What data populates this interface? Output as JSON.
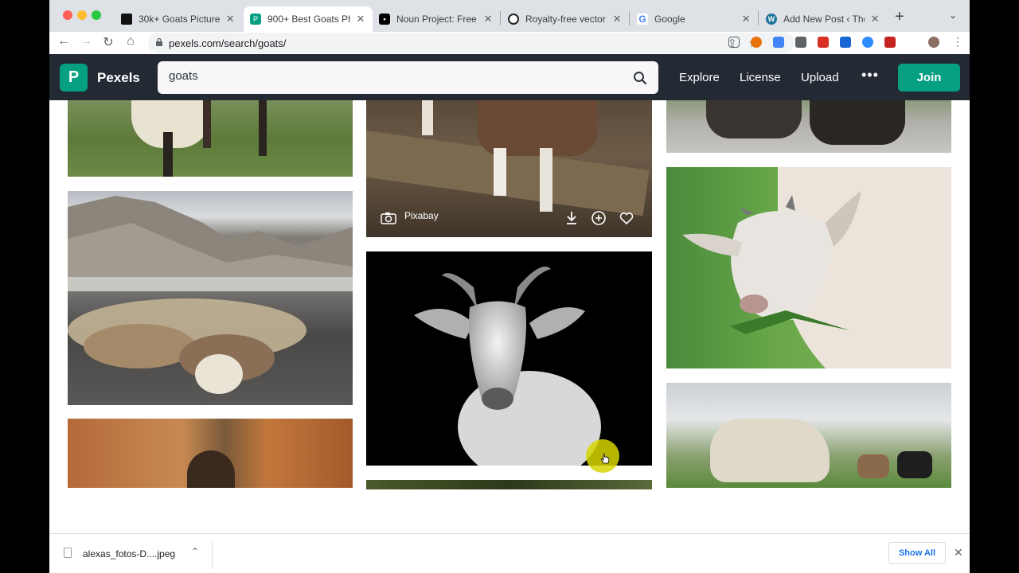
{
  "browser": {
    "tabs": [
      {
        "label": "30k+ Goats Pictures |",
        "active": false,
        "icon": "unsplash-icon"
      },
      {
        "label": "900+ Best Goats Pho",
        "active": true,
        "icon": "pexels-icon"
      },
      {
        "label": "Noun Project: Free Ic",
        "active": false,
        "icon": "noun-project-icon"
      },
      {
        "label": "Royalty-free vector cl",
        "active": false,
        "icon": "vector-site-icon"
      },
      {
        "label": "Google",
        "active": false,
        "icon": "google-icon"
      },
      {
        "label": "Add New Post ‹ The",
        "active": false,
        "icon": "wordpress-icon"
      }
    ],
    "url": "pexels.com/search/goats/"
  },
  "pexels": {
    "brand": "Pexels",
    "logo_letter": "P",
    "search_value": "goats",
    "nav": [
      "Explore",
      "License",
      "Upload"
    ],
    "more": "•••",
    "join_label": "Join",
    "hover_photographer": "Pixabay"
  },
  "download_bar": {
    "file_name": "alexas_fotos-D....jpeg",
    "show_all_label": "Show All"
  },
  "colors": {
    "brand": "#05a081",
    "header_bg": "#232a34",
    "cursor_highlight": "#d6d600"
  }
}
